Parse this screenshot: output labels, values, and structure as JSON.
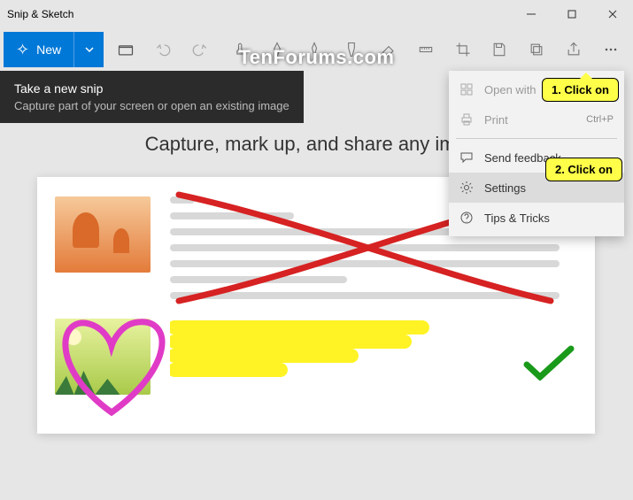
{
  "window": {
    "title": "Snip & Sketch"
  },
  "toolbar": {
    "new_label": "New"
  },
  "tooltip": {
    "heading": "Take a new snip",
    "sub": "Capture part of your screen or open an existing image"
  },
  "watermark": "TenForums.com",
  "heading": "Capture, mark up, and share any image",
  "menu": {
    "open_with": "Open with",
    "print": "Print",
    "print_shortcut": "Ctrl+P",
    "send_feedback": "Send feedback",
    "settings": "Settings",
    "tips": "Tips & Tricks"
  },
  "callouts": {
    "c1": "1. Click on",
    "c2": "2. Click on"
  }
}
